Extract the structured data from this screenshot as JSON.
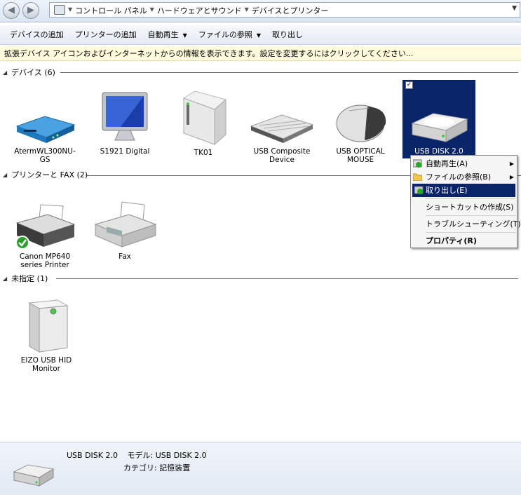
{
  "address_bar": {
    "breadcrumbs": [
      "コントロール パネル",
      "ハードウェアとサウンド",
      "デバイスとプリンター"
    ]
  },
  "toolbar": {
    "items": [
      {
        "label": "デバイスの追加",
        "dropdown": false
      },
      {
        "label": "プリンターの追加",
        "dropdown": false
      },
      {
        "label": "自動再生",
        "dropdown": true
      },
      {
        "label": "ファイルの参照",
        "dropdown": true
      },
      {
        "label": "取り出し",
        "dropdown": false
      }
    ]
  },
  "info_bar": "拡張デバイス アイコンおよびインターネットからの情報を表示できます。設定を変更するにはクリックしてください...",
  "groups": {
    "devices": {
      "title": "デバイス (6)",
      "items": [
        {
          "label": "AtermWL300NU-GS",
          "icon": "router-icon"
        },
        {
          "label": "S1921 Digital",
          "icon": "monitor-icon"
        },
        {
          "label": "TK01",
          "icon": "external-drive-icon"
        },
        {
          "label": "USB Composite Device",
          "icon": "keyboard-icon"
        },
        {
          "label": "USB OPTICAL MOUSE",
          "icon": "mouse-icon"
        },
        {
          "label": "USB DISK 2.0",
          "icon": "usb-disk-icon",
          "selected": true
        }
      ]
    },
    "printers": {
      "title": "プリンターと FAX (2)",
      "items": [
        {
          "label": "Canon MP640 series Printer",
          "icon": "printer-icon",
          "default": true
        },
        {
          "label": "Fax",
          "icon": "fax-icon"
        }
      ]
    },
    "unspecified": {
      "title": "未指定 (1)",
      "items": [
        {
          "label": "EIZO USB HID Monitor",
          "icon": "hid-device-icon"
        }
      ]
    }
  },
  "context_menu": {
    "items": [
      {
        "label": "自動再生(A)",
        "submenu": true,
        "icon": "autoplay-icon"
      },
      {
        "label": "ファイルの参照(B)",
        "submenu": true,
        "icon": "folder-icon"
      },
      {
        "label": "取り出し(E)",
        "highlighted": true,
        "icon": "eject-icon"
      },
      {
        "label": "ショートカットの作成(S)"
      },
      {
        "label": "トラブルシューティング(T)"
      },
      {
        "label": "プロパティ(R)",
        "bold": true
      }
    ]
  },
  "status": {
    "name": "USB DISK 2.0",
    "model_label": "モデル:",
    "model_value": "USB DISK 2.0",
    "category_label": "カテゴリ:",
    "category_value": "記憶装置"
  },
  "colors": {
    "selection": "#0a246a",
    "info_bar": "#fffbdc"
  }
}
